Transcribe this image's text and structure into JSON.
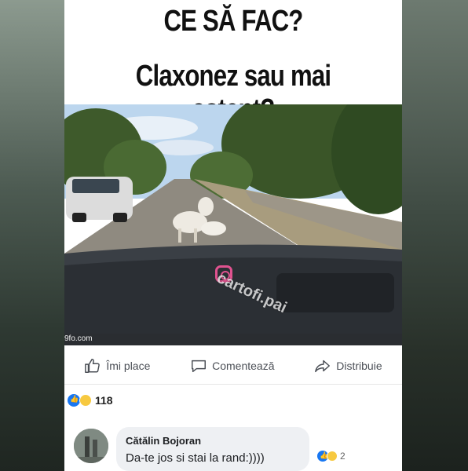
{
  "meme": {
    "title_line1": "CE SĂ FAC?",
    "title_line2": "Claxonez sau mai aștept?",
    "watermark": "cartofi.pai",
    "source_tag": "9fo.com"
  },
  "actions": {
    "like_label": "Îmi place",
    "comment_label": "Comentează",
    "share_label": "Distribuie"
  },
  "reactions": {
    "count": "118",
    "icons": [
      "like-icon",
      "haha-icon"
    ]
  },
  "comment": {
    "author": "Cătălin Bojoran",
    "text": "Da-te jos si stai la rand:))))",
    "reaction_count": "2"
  },
  "colors": {
    "like_blue": "#1877f2",
    "haha_yellow": "#f7c940",
    "action_text": "#4b4f56"
  }
}
